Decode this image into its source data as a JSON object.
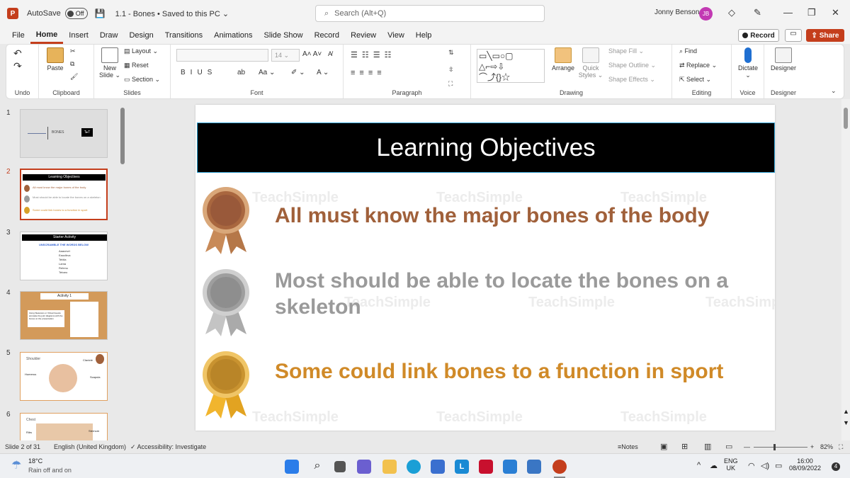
{
  "app": {
    "logo": "P",
    "autosave_label": "AutoSave",
    "autosave_state": "Off",
    "doc_title": "1.1 - Bones • Saved to this PC ⌄",
    "search_placeholder": "Search (Alt+Q)",
    "user_name": "Jonny Benson",
    "user_initials": "JB"
  },
  "menu": [
    "File",
    "Home",
    "Insert",
    "Draw",
    "Design",
    "Transitions",
    "Animations",
    "Slide Show",
    "Record",
    "Review",
    "View",
    "Help"
  ],
  "menu_active": "Home",
  "record_label": "Record",
  "share_label": "Share",
  "ribbon": {
    "undo_label": "Undo",
    "clipboard_label": "Clipboard",
    "paste_label": "Paste",
    "slides_label": "Slides",
    "new_slide_label": "New Slide ⌄",
    "layout_label": "Layout ⌄",
    "reset_label": "Reset",
    "section_label": "Section ⌄",
    "font_label": "Font",
    "font_size": "14",
    "paragraph_label": "Paragraph",
    "drawing_label": "Drawing",
    "arrange_label": "Arrange",
    "quick_styles_label": "Quick Styles ⌄",
    "shape_fill": "Shape Fill ⌄",
    "shape_outline": "Shape Outline ⌄",
    "shape_effects": "Shape Effects ⌄",
    "find_label": "Find",
    "replace_label": "Replace ⌄",
    "select_label": "Select ⌄",
    "editing_label": "Editing",
    "dictate_label": "Dictate ⌄",
    "voice_label": "Voice",
    "designer_label": "Designer",
    "designer_group_label": "Designer"
  },
  "thumbs": [
    {
      "num": "1",
      "title": "BONES",
      "logo": "T▸T"
    },
    {
      "num": "2",
      "title": "Learning Objectives",
      "l1": "All must know the major bones of the body",
      "l2": "Most should be able to locate the bones on a skeleton",
      "l3": "Some could link bones to a function in sport"
    },
    {
      "num": "3",
      "title": "Starter Activity",
      "sub": "UNSCRAMBLE THE WORDS BELOW",
      "words": [
        "Aaacnvrt",
        "Eaoclbva",
        "Teblia",
        "Lama",
        "Rehmu",
        "Tebaro"
      ]
    },
    {
      "num": "4",
      "title": "Activity 1",
      "text": "Using Skeletons or Virtual Guests annotate the joint diagrams with the bones on the presentation"
    },
    {
      "num": "5",
      "title": "Shoulder",
      "a": "Clavicle",
      "b": "Humerus",
      "c": "Scapula"
    },
    {
      "num": "6",
      "title": "Chest",
      "a": "Ribs",
      "b": "Sternum"
    }
  ],
  "slide": {
    "title": "Learning Objectives",
    "obj1": "All must know the major bones of the body",
    "obj2": "Most should be able to locate the bones on a skeleton",
    "obj3": "Some could link bones to a function in sport",
    "watermark": "TeachSimple"
  },
  "colors": {
    "accent": "#c43e1c",
    "bronze": "#a0603a",
    "silver": "#9a9a9a",
    "gold": "#d08a28",
    "title_bar": "#000000"
  },
  "status": {
    "slide_of": "Slide 2 of 31",
    "language": "English (United Kingdom)",
    "accessibility": "Accessibility: Investigate",
    "notes": "Notes",
    "zoom": "82%"
  },
  "taskbar": {
    "temp": "18°C",
    "weather": "Rain off and on",
    "lang1": "ENG",
    "lang2": "UK",
    "time": "16:00",
    "date": "08/09/2022",
    "notif": "4"
  }
}
